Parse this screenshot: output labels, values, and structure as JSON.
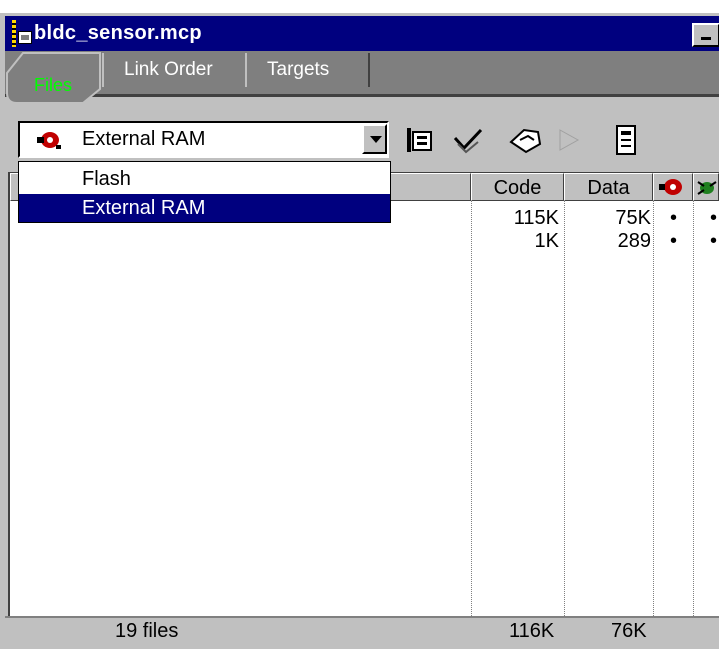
{
  "window": {
    "title": "bldc_sensor.mcp"
  },
  "tabs": [
    {
      "label": "Files",
      "active": true
    },
    {
      "label": "Link Order",
      "active": false
    },
    {
      "label": "Targets",
      "active": false
    }
  ],
  "toolbar": {
    "target_selected": "External RAM",
    "target_options": [
      "Flash",
      "External RAM"
    ],
    "buttons": [
      "settings-icon",
      "check-syntax-icon",
      "make-icon",
      "debug-run-icon",
      "project-inspector-icon"
    ]
  },
  "columns": {
    "code": "Code",
    "data": "Data"
  },
  "rows": [
    {
      "code": "115K",
      "data": "75K",
      "debug": "•",
      "check": "•"
    },
    {
      "code": "1K",
      "data": "289",
      "debug": "•",
      "check": "•"
    }
  ],
  "status": {
    "files": "19 files",
    "code_total": "116K",
    "data_total": "76K"
  },
  "colors": {
    "titlebar": "#00007f",
    "selection": "#00007f",
    "active_tab_text": "#00ff00",
    "chrome": "#c0c0c0"
  }
}
